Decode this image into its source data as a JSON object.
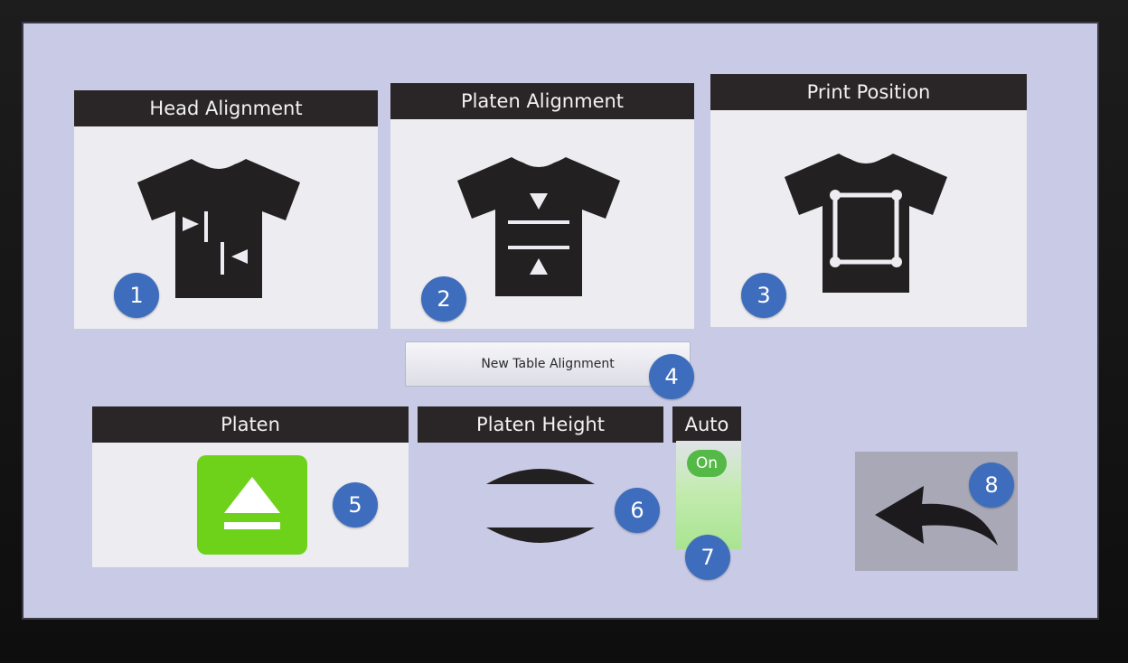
{
  "tiles": {
    "head_alignment": {
      "label": "Head Alignment"
    },
    "platen_alignment": {
      "label": "Platen Alignment"
    },
    "print_position": {
      "label": "Print Position"
    }
  },
  "new_table_alignment": {
    "label": "New Table Alignment"
  },
  "platen": {
    "label": "Platen",
    "icon": "eject-icon",
    "accent": "#6ed21a"
  },
  "platen_height": {
    "label": "Platen Height",
    "icons": [
      "arrow-up-icon",
      "arrow-down-icon"
    ]
  },
  "auto": {
    "label": "Auto",
    "state_label": "On",
    "state_color": "#55b947"
  },
  "back": {
    "icon": "back-arrow-icon"
  },
  "badges": [
    "1",
    "2",
    "3",
    "4",
    "5",
    "6",
    "7",
    "8"
  ],
  "colors": {
    "screen_bg": "#c9cbe6",
    "header_bg": "#2a2527",
    "badge": "#3f6dbd"
  }
}
